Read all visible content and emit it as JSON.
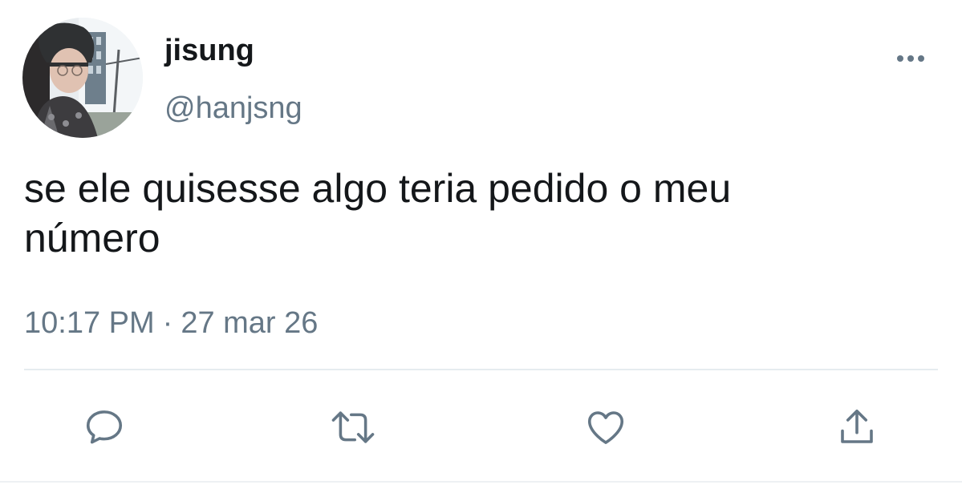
{
  "user": {
    "display_name": "jisung",
    "handle": "@hanjsng",
    "avatar_icon": "profile-photo"
  },
  "tweet": {
    "text_line1": "se ele quisesse algo teria pedido o meu",
    "text_line2": "número",
    "time": "10:17 PM",
    "separator": "·",
    "date": "27 mar 26"
  },
  "actions": {
    "reply_icon": "speech-bubble-icon",
    "retweet_icon": "retweet-arrows-icon",
    "like_icon": "heart-icon",
    "share_icon": "share-upload-icon",
    "more_icon": "ellipsis-icon"
  },
  "colors": {
    "text": "#14171a",
    "secondary": "#657786",
    "icon": "#657786",
    "divider": "#e6ecf0"
  }
}
